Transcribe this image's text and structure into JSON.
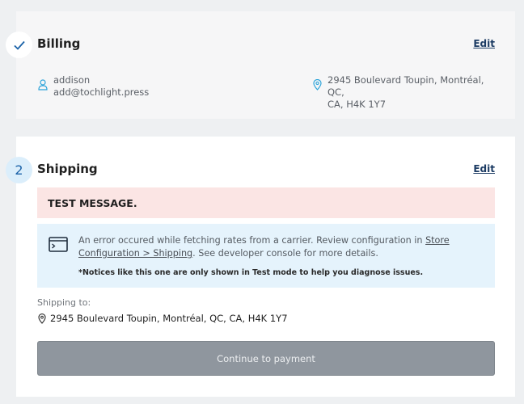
{
  "billing": {
    "title": "Billing",
    "edit_label": "Edit",
    "name": "addison",
    "email": "add@tochlight.press",
    "address_line1": "2945 Boulevard Toupin, Montréal, QC,",
    "address_line2": "CA, H4K 1Y7",
    "step_icon": "checkmark-icon"
  },
  "shipping": {
    "step_number": "2",
    "title": "Shipping",
    "edit_label": "Edit",
    "test_message": "TEST MESSAGE.",
    "notice": {
      "text_before": "An error occured while fetching rates from a carrier. Review configuration in ",
      "link_text": "Store Configuration > Shipping",
      "text_after": ". See developer console for more details.",
      "footnote": "*Notices like this one are only shown in Test mode to help you diagnose issues."
    },
    "shipping_to_label": "Shipping to:",
    "shipping_address": "2945 Boulevard Toupin, Montréal, QC, CA, H4K 1Y7",
    "continue_label": "Continue to payment"
  },
  "colors": {
    "accent": "#1a62a8",
    "error_bg": "#fbe5e4",
    "notice_bg": "#e5f3fc",
    "button_disabled": "#8f969e"
  }
}
